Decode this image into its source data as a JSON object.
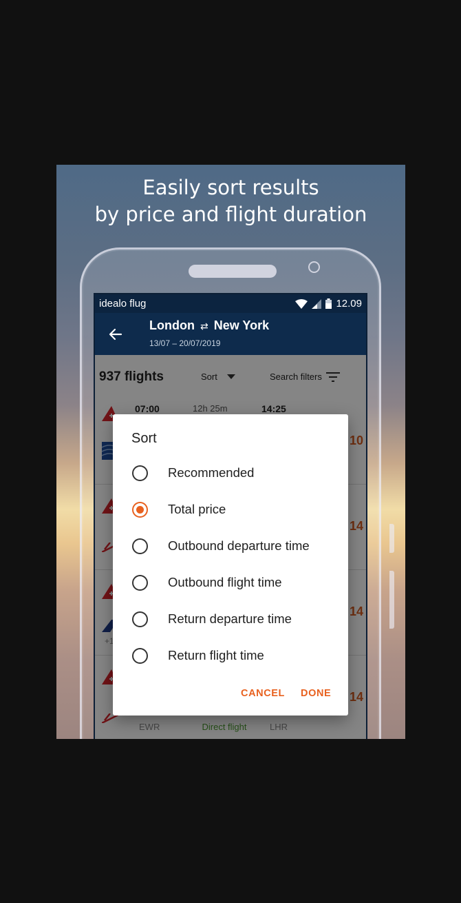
{
  "promo": {
    "headline_line1": "Easily sort results",
    "headline_line2": "by price and flight duration"
  },
  "status_bar": {
    "app_name": "idealo flug",
    "time": "12.09"
  },
  "app_bar": {
    "origin": "London",
    "swap_symbol": "⇄",
    "destination": "New York",
    "dates": "13/07 – 20/07/2019"
  },
  "toolbar": {
    "flight_count": "937 flights",
    "sort_label": "Sort",
    "filters_label": "Search filters"
  },
  "results": [
    {
      "dep_time": "07:00",
      "duration": "12h 25m",
      "arr_time": "14:25",
      "price_fragment": "10"
    },
    {
      "price_fragment": "14"
    },
    {
      "price_fragment": "14",
      "extra": "+1"
    },
    {
      "price_fragment": "14",
      "dep_airport": "EWR",
      "stops": "Direct flight",
      "arr_airport": "LHR"
    }
  ],
  "sort_dialog": {
    "title": "Sort",
    "options": [
      {
        "label": "Recommended",
        "selected": false
      },
      {
        "label": "Total price",
        "selected": true
      },
      {
        "label": "Outbound departure time",
        "selected": false
      },
      {
        "label": "Outbound flight time",
        "selected": false
      },
      {
        "label": "Return departure time",
        "selected": false
      },
      {
        "label": "Return flight time",
        "selected": false
      }
    ],
    "cancel_label": "CANCEL",
    "done_label": "DONE"
  },
  "colors": {
    "accent": "#e8611f",
    "app_bar": "#0e2b4c",
    "status_bar": "#0c2440",
    "price": "#d65a1f",
    "direct": "#4a9a2e"
  }
}
